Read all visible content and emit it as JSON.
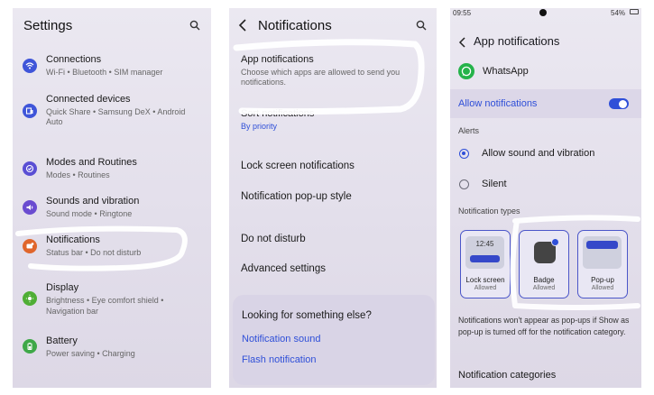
{
  "panel1": {
    "title": "Settings",
    "items": [
      {
        "label": "Connections",
        "sub": "Wi-Fi  •  Bluetooth  •  SIM manager",
        "icon": "wifi-icon",
        "color": "#3f55d9"
      },
      {
        "label": "Connected devices",
        "sub": "Quick Share  •  Samsung DeX  •  Android",
        "sub2": "Auto",
        "icon": "devices-icon",
        "color": "#3f55d9"
      },
      {
        "label": "Modes and Routines",
        "sub": "Modes  •  Routines",
        "icon": "check-circle-icon",
        "color": "#5a4fd4"
      },
      {
        "label": "Sounds and vibration",
        "sub": "Sound mode  •  Ringtone",
        "icon": "volume-icon",
        "color": "#6a4cd0"
      },
      {
        "label": "Notifications",
        "sub": "Status bar  •  Do not disturb",
        "icon": "bell-icon",
        "color": "#e0662c"
      },
      {
        "label": "Display",
        "sub": "Brightness  •  Eye comfort shield  •",
        "sub2": "Navigation bar",
        "icon": "sun-icon",
        "color": "#4fae35"
      },
      {
        "label": "Battery",
        "sub": "Power saving  •  Charging",
        "icon": "battery-icon",
        "color": "#3ea848"
      }
    ]
  },
  "panel2": {
    "title": "Notifications",
    "app_notif_title": "App notifications",
    "app_notif_sub": "Choose which apps are allowed to send you notifications.",
    "sort_title": "Sort notifications",
    "sort_sub": "By priority",
    "items": [
      "Lock screen notifications",
      "Notification pop-up style",
      "Do not disturb",
      "Advanced settings"
    ],
    "looking": "Looking for something else?",
    "links": [
      "Notification sound",
      "Flash notification"
    ]
  },
  "panel3": {
    "status_time": "09:55",
    "status_right": "54%",
    "title": "App notifications",
    "app_name": "WhatsApp",
    "allow": "Allow notifications",
    "alerts": "Alerts",
    "opt_sound": "Allow sound and vibration",
    "opt_silent": "Silent",
    "types_label": "Notification types",
    "cards": [
      {
        "label": "Lock screen",
        "sub": "Allowed",
        "clock": "12:45"
      },
      {
        "label": "Badge",
        "sub": "Allowed"
      },
      {
        "label": "Pop-up",
        "sub": "Allowed"
      }
    ],
    "note": "Notifications won't appear as pop-ups if Show as pop-up is turned off for the notification category.",
    "categories": "Notification categories"
  },
  "colors": {
    "accent": "#2f4fd8",
    "whatsapp": "#25b34a"
  }
}
